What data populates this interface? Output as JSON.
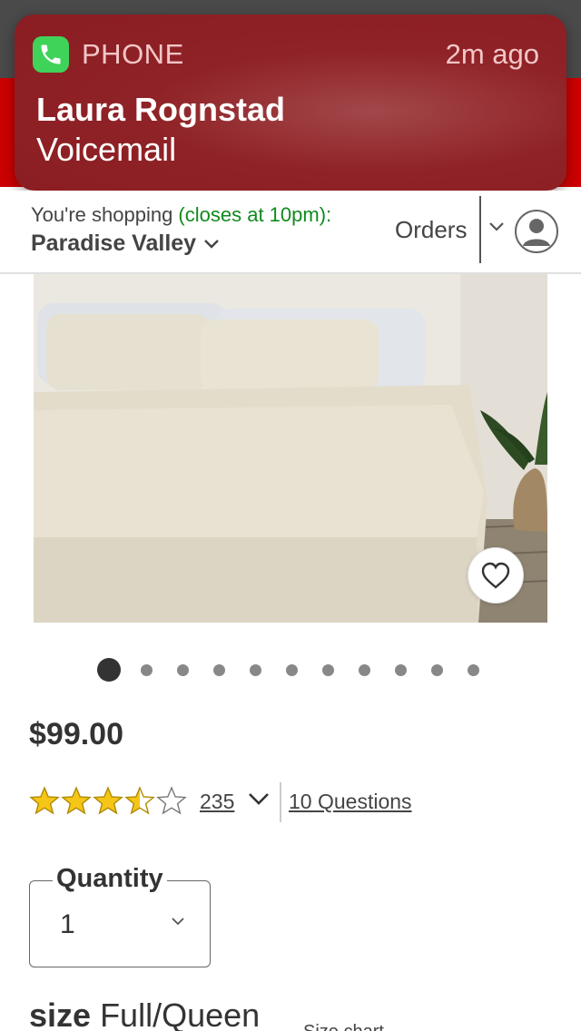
{
  "notification": {
    "app_name": "PHONE",
    "time": "2m ago",
    "title": "Laura Rognstad",
    "body": "Voicemail",
    "icon": "phone-icon"
  },
  "header": {
    "shopping_prefix": "You're shopping ",
    "closes": "(closes at 10pm):",
    "store": "Paradise Valley",
    "orders": "Orders",
    "account_icon": "account-icon"
  },
  "product": {
    "image_alt": "bed-with-linen-duvet",
    "price": "$99.00",
    "rating": 3.5,
    "rating_max": 5,
    "review_count": "235",
    "questions": "10 Questions",
    "carousel": {
      "count": 11,
      "active": 0
    }
  },
  "quantity": {
    "label": "Quantity",
    "value": "1"
  },
  "size": {
    "label": "size",
    "value": "Full/Queen",
    "chart_link": "Size chart"
  },
  "colors": {
    "brand_red": "#cc0000",
    "notification": "#8a1d22",
    "green": "#118a1f",
    "star": "#f5c518"
  }
}
